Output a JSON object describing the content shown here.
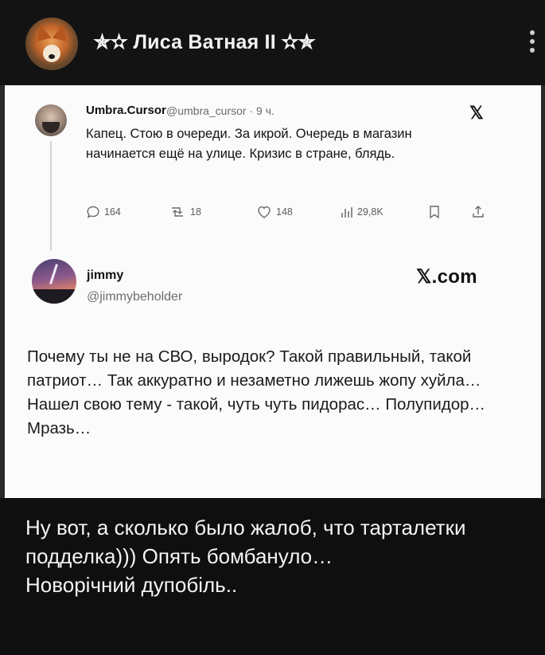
{
  "channel": {
    "title": "✯✫ Лиса Ватная ІІ ✫✯",
    "avatar_icon": "fox-avatar-icon",
    "menu_icon": "more-vertical-icon"
  },
  "quoted_tweet": {
    "author_name": "Umbra.Cursor",
    "meta": "@umbra_cursor · 9 ч.",
    "text": "Капец. Стою в очереди. За икрой. Очередь в магазин начинается ещё на улице. Кризис в стране, блядь.",
    "platform_icon": "x-logo-icon",
    "actions": {
      "replies": "164",
      "retweets": "18",
      "likes": "148",
      "views": "29,8K"
    }
  },
  "reply_tweet": {
    "author_name": "jimmy",
    "handle": "@jimmybeholder",
    "brand": "𝕏.com",
    "text": "Почему ты не на СВО, выродок? Такой правильный, такой патриот… Так аккуратно и незаметно лижешь жопу хуйла… Нашел свою тему - такой, чуть чуть пидорас… Полупидор… Мразь…"
  },
  "post_caption": "Ну вот, а сколько было жалоб, что тарталетки подделка))) Опять бомбануло…\nНоворічний дупобіль..",
  "colors": {
    "background": "#0f0f0f",
    "header": "#131313",
    "screenshot_bg": "#fbfbfb",
    "caption_text": "#f4f4f4"
  }
}
